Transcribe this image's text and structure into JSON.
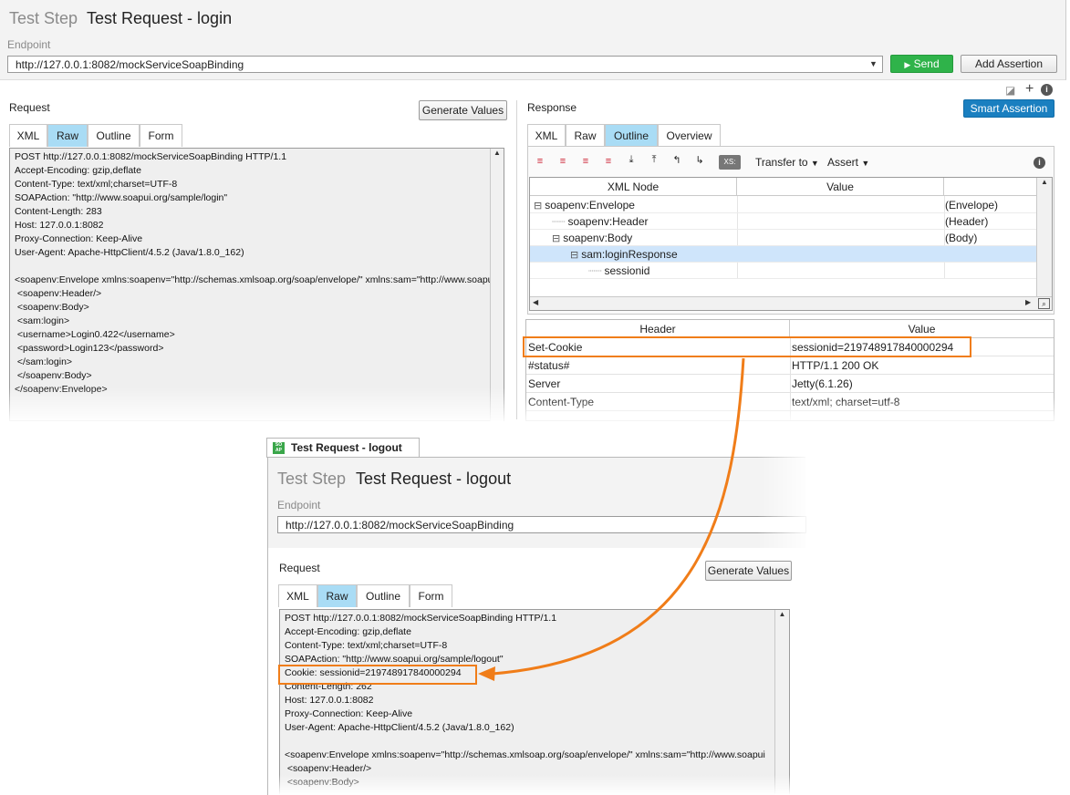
{
  "login": {
    "title_prefix": "Test Step",
    "title": "Test Request - login",
    "endpoint_label": "Endpoint",
    "endpoint_value": "http://127.0.0.1:8082/mockServiceSoapBinding",
    "send_label": "Send",
    "add_assertion_label": "Add Assertion",
    "request_label": "Request",
    "generate_values_label": "Generate Values",
    "request_tabs": [
      "XML",
      "Raw",
      "Outline",
      "Form"
    ],
    "request_active_tab": "Raw",
    "raw_lines": [
      "POST http://127.0.0.1:8082/mockServiceSoapBinding HTTP/1.1",
      "Accept-Encoding: gzip,deflate",
      "Content-Type: text/xml;charset=UTF-8",
      "SOAPAction: \"http://www.soapui.org/sample/login\"",
      "Content-Length: 283",
      "Host: 127.0.0.1:8082",
      "Proxy-Connection: Keep-Alive",
      "User-Agent: Apache-HttpClient/4.5.2 (Java/1.8.0_162)",
      "",
      "<soapenv:Envelope xmlns:soapenv=\"http://schemas.xmlsoap.org/soap/envelope/\" xmlns:sam=\"http://www.soapui",
      " <soapenv:Header/>",
      " <soapenv:Body>",
      " <sam:login>",
      " <username>Login0.422</username>",
      " <password>Login123</password>",
      " </sam:login>",
      " </soapenv:Body>",
      "</soapenv:Envelope>"
    ],
    "response_label": "Response",
    "smart_assertion_label": "Smart Assertion",
    "response_tabs": [
      "XML",
      "Raw",
      "Outline",
      "Overview"
    ],
    "response_active_tab": "Outline",
    "transfer_to_label": "Transfer to",
    "assert_label": "Assert",
    "xs_label": "XS:",
    "tree_headers": [
      "XML Node",
      "Value",
      ""
    ],
    "tree_rows": [
      {
        "name": "soapenv:Envelope",
        "type": "(Envelope)",
        "toggle": "⊟"
      },
      {
        "name": "soapenv:Header",
        "type": "(Header)",
        "toggle": ""
      },
      {
        "name": "soapenv:Body",
        "type": "(Body)",
        "toggle": "⊟"
      },
      {
        "name": "sam:loginResponse",
        "type": "",
        "toggle": "⊟"
      },
      {
        "name": "sessionid",
        "type": "",
        "toggle": ""
      }
    ],
    "header_table_headers": [
      "Header",
      "Value"
    ],
    "header_rows": [
      {
        "header": "Set-Cookie",
        "value": "sessionid=219748917840000294"
      },
      {
        "header": "#status#",
        "value": "HTTP/1.1 200 OK"
      },
      {
        "header": "Server",
        "value": "Jetty(6.1.26)"
      },
      {
        "header": "Content-Type",
        "value": "text/xml; charset=utf-8"
      }
    ]
  },
  "logout": {
    "tab_label": "Test Request - logout",
    "tab_icon_text": "SO AP",
    "title_prefix": "Test Step",
    "title": "Test Request - logout",
    "endpoint_label": "Endpoint",
    "endpoint_value": "http://127.0.0.1:8082/mockServiceSoapBinding",
    "request_label": "Request",
    "generate_values_label": "Generate Values",
    "request_tabs": [
      "XML",
      "Raw",
      "Outline",
      "Form"
    ],
    "request_active_tab": "Raw",
    "raw_lines": [
      "POST http://127.0.0.1:8082/mockServiceSoapBinding HTTP/1.1",
      "Accept-Encoding: gzip,deflate",
      "Content-Type: text/xml;charset=UTF-8",
      "SOAPAction: \"http://www.soapui.org/sample/logout\"",
      "Cookie: sessionid=219748917840000294",
      "Content-Length: 262",
      "Host: 127.0.0.1:8082",
      "Proxy-Connection: Keep-Alive",
      "User-Agent: Apache-HttpClient/4.5.2 (Java/1.8.0_162)",
      "",
      "<soapenv:Envelope xmlns:soapenv=\"http://schemas.xmlsoap.org/soap/envelope/\" xmlns:sam=\"http://www.soapui",
      " <soapenv:Header/>",
      " <soapenv:Body>"
    ]
  },
  "colors": {
    "accent_orange": "#f07d19",
    "send_green": "#2fb34a",
    "smart_blue": "#1a7fc0",
    "active_tab": "#a9dcf5"
  }
}
